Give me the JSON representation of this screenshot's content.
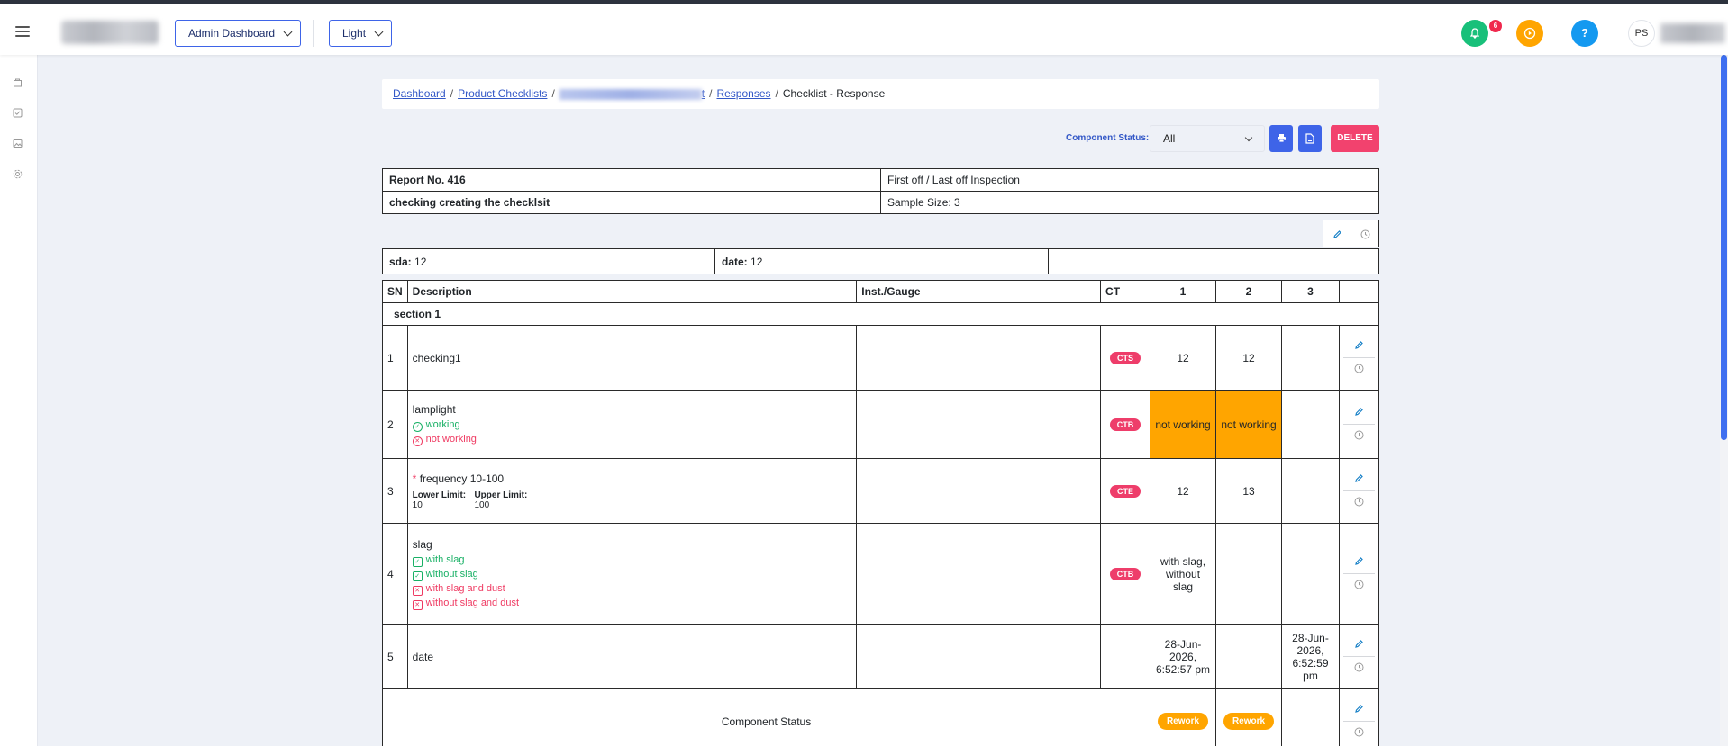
{
  "header": {
    "menu_icon": "hamburger-icon",
    "dashboard_dropdown": "Admin Dashboard",
    "theme_dropdown": "Light",
    "notification_count": "6",
    "help_glyph": "?",
    "avatar_initials": "PS",
    "colors": {
      "notification": "#18c07a",
      "play": "#ffa500",
      "help": "#1499f0"
    }
  },
  "sidebar": {
    "icons": [
      "bag-icon",
      "checklist-icon",
      "image-icon",
      "settings-icon"
    ]
  },
  "breadcrumb": {
    "items": [
      "Dashboard",
      "Product Checklists",
      "t",
      "Responses"
    ],
    "current": "Checklist - Response",
    "separator": "/"
  },
  "toolbar": {
    "component_status_label": "Component Status:",
    "component_status_value": "All",
    "delete_label": "DELETE"
  },
  "report": {
    "number": "Report No. 416",
    "inspection_type": "First off / Last off Inspection",
    "checklist_name": "checking creating the checklsit",
    "sample_size": "Sample Size: 3"
  },
  "meta": [
    {
      "label": "sda:",
      "value": "12"
    },
    {
      "label": "date:",
      "value": "12"
    }
  ],
  "table": {
    "headers": [
      "SN",
      "Description",
      "Inst./Gauge",
      "CT",
      "1",
      "2",
      "3"
    ],
    "section": "section 1",
    "rows": [
      {
        "sn": "1",
        "description": "checking1",
        "ct": "CTS",
        "v1": "12",
        "v2": "12",
        "v3": ""
      },
      {
        "sn": "2",
        "description": "lamplight",
        "options_ok": [
          "working"
        ],
        "options_bad": [
          "not working"
        ],
        "ct": "CTB",
        "v1": "not working",
        "v2": "not working",
        "v3": ""
      },
      {
        "sn": "3",
        "required_mark": "*",
        "description": "frequency 10-100",
        "lower_label": "Lower Limit:",
        "lower_value": "10",
        "upper_label": "Upper Limit:",
        "upper_value": "100",
        "ct": "CTE",
        "v1": "12",
        "v2": "13",
        "v3": ""
      },
      {
        "sn": "4",
        "description": "slag",
        "options_ok": [
          "with slag",
          "without slag"
        ],
        "options_bad": [
          "with slag and dust",
          "without slag and dust"
        ],
        "ct": "CTB",
        "v1": "with slag, without slag",
        "v2": "",
        "v3": ""
      },
      {
        "sn": "5",
        "description": "date",
        "ct": "",
        "v1": "28-Jun-2026, 6:52:57 pm",
        "v2": "",
        "v3": "28-Jun-2026, 6:52:59 pm"
      }
    ],
    "component_status": {
      "label": "Component Status",
      "v1": "Rework",
      "v2": "Rework"
    }
  }
}
